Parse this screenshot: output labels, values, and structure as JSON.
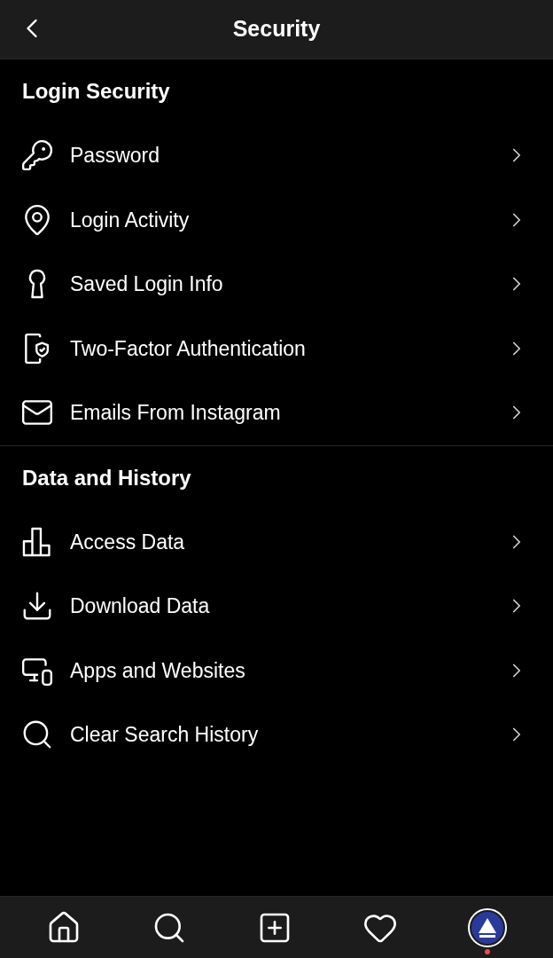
{
  "header": {
    "title": "Security"
  },
  "sections": [
    {
      "title": "Login Security",
      "items": [
        {
          "label": "Password"
        },
        {
          "label": "Login Activity"
        },
        {
          "label": "Saved Login Info"
        },
        {
          "label": "Two-Factor Authentication"
        },
        {
          "label": "Emails From Instagram"
        }
      ]
    },
    {
      "title": "Data and History",
      "items": [
        {
          "label": "Access Data"
        },
        {
          "label": "Download Data"
        },
        {
          "label": "Apps and Websites"
        },
        {
          "label": "Clear Search History"
        }
      ]
    }
  ],
  "tab_bar": [
    {
      "selected": false
    },
    {
      "selected": false
    },
    {
      "selected": false
    },
    {
      "selected": false
    },
    {
      "selected": true,
      "has_notification": true
    }
  ]
}
